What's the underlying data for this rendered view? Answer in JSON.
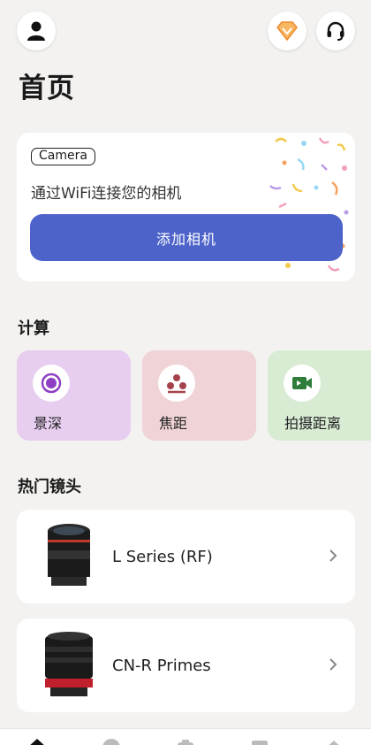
{
  "header": {
    "title": "首页",
    "icons": [
      "user-icon",
      "vip-badge-icon",
      "support-headset-icon"
    ]
  },
  "camera_card": {
    "tag": "Camera",
    "description": "通过WiFi连接您的相机",
    "button_label": "添加相机",
    "button_color": "#4d63c9"
  },
  "calculate": {
    "section_title": "计算",
    "tiles": [
      {
        "label": "景深",
        "icon": "depth-of-field-icon",
        "color": "#e7cdef"
      },
      {
        "label": "焦距",
        "icon": "focal-length-icon",
        "color": "#f0d3d6"
      },
      {
        "label": "拍摄距离",
        "icon": "video-camera-icon",
        "color": "#d8ebd3"
      }
    ]
  },
  "lenses": {
    "section_title": "热门镜头",
    "items": [
      {
        "name": "L Series (RF)",
        "icon": "lens-image"
      },
      {
        "name": "CN-R Primes",
        "icon": "cinema-lens-image"
      }
    ]
  },
  "bottom_nav": {
    "items": [
      "home-icon",
      "explore-icon",
      "camera-icon",
      "gallery-icon",
      "profile-icon"
    ]
  }
}
